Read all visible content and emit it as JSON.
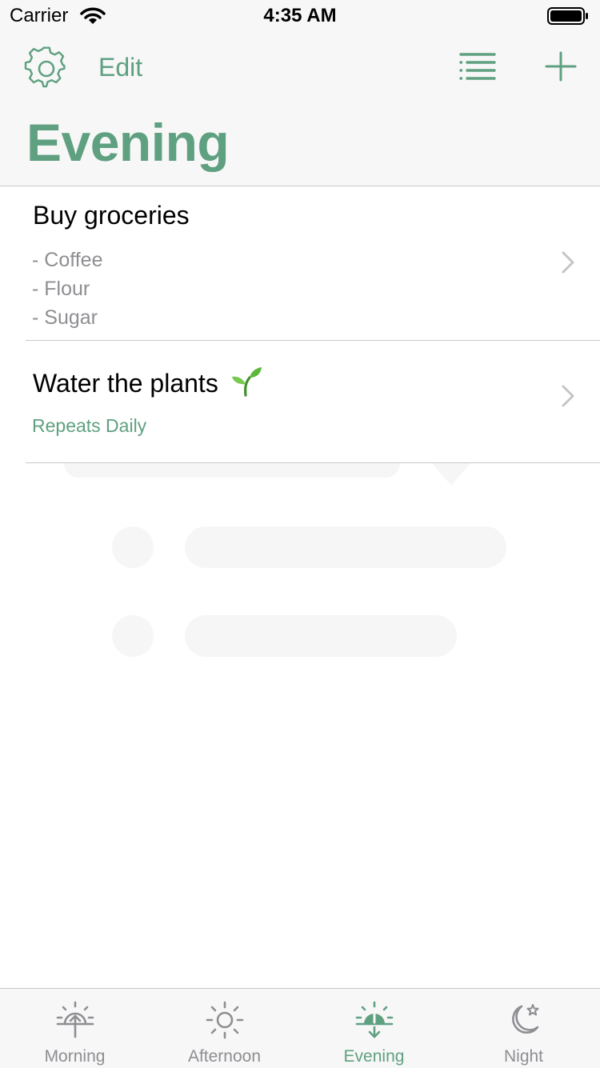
{
  "status_bar": {
    "carrier": "Carrier",
    "time": "4:35 AM"
  },
  "nav": {
    "edit_label": "Edit",
    "title": "Evening"
  },
  "tasks": [
    {
      "title": "Buy groceries",
      "notes": [
        "- Coffee",
        "- Flour",
        "- Sugar"
      ]
    },
    {
      "title": "Water the plants",
      "emoji": "🌱",
      "repeat": "Repeats Daily"
    }
  ],
  "tabs": [
    {
      "label": "Morning",
      "icon": "sunrise-icon",
      "active": false
    },
    {
      "label": "Afternoon",
      "icon": "sun-icon",
      "active": false
    },
    {
      "label": "Evening",
      "icon": "sunset-icon",
      "active": true
    },
    {
      "label": "Night",
      "icon": "moon-star-icon",
      "active": false
    }
  ],
  "colors": {
    "accent": "#5fa081",
    "secondary_text": "#8e8e93",
    "bar_background": "#f7f7f7",
    "separator": "#c8c8cc"
  }
}
